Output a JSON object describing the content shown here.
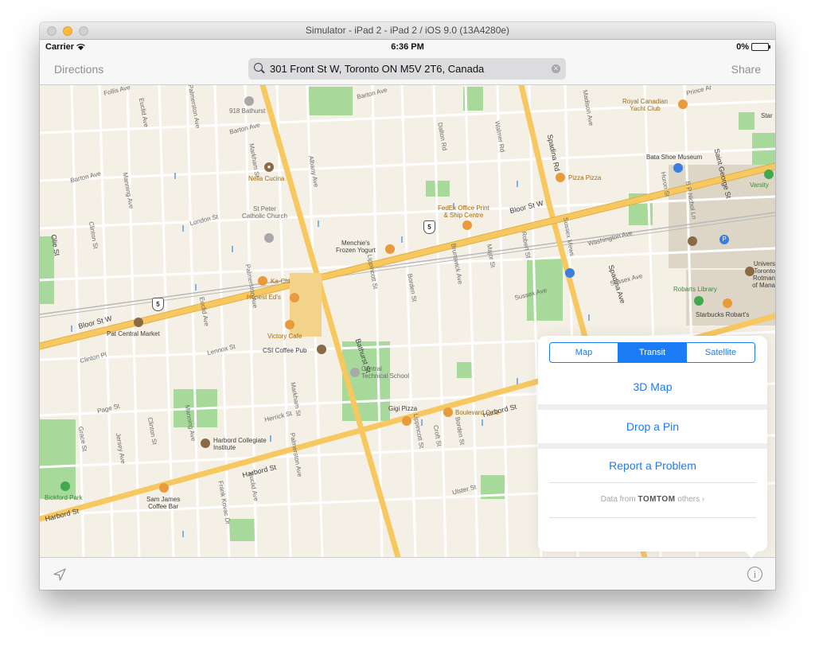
{
  "window": {
    "title": "Simulator - iPad 2 - iPad 2 / iOS 9.0 (13A4280e)"
  },
  "status_bar": {
    "carrier": "Carrier",
    "time": "6:36 PM",
    "battery": "0%"
  },
  "nav_bar": {
    "directions_label": "Directions",
    "search_value": "301 Front St W, Toronto ON M5V 2T6, Canada",
    "share_label": "Share"
  },
  "map": {
    "streets": {
      "bloor_w": "Bloor St W",
      "bloor_w2": "Bloor St W",
      "harbord": "Harbord St",
      "harbord2": "Harbord St",
      "harbord3": "Harbord St",
      "bathurst": "Bathurst St",
      "spadina": "Spadina Rd",
      "spadina_ave": "Spadina Ave",
      "barton": "Barton Ave",
      "barton2": "Barton Ave",
      "barton3": "Barton Ave",
      "london": "London St",
      "lennox": "Lennox St",
      "clinton_pl": "Clinton Pl",
      "page": "Page St",
      "herrick": "Herrick St",
      "ulster": "Ulster St",
      "sussex": "Sussex Ave",
      "sussex_mews": "Sussex Mews",
      "washington": "Washington Ave",
      "euclid": "Euclid Ave",
      "palmerston": "Palmerston Ave",
      "markham": "Markham St",
      "albany": "Albany Ave",
      "dalton": "Dalton Rd",
      "walmer": "Walmer Rd",
      "madison": "Madison Ave",
      "huron": "Huron St",
      "st_george": "Saint George St",
      "manning": "Manning Ave",
      "clinton": "Clinton St",
      "lippincott": "Lippincott St",
      "borden": "Borden St",
      "brunswick": "Brunswick Ave",
      "major": "Major St",
      "robert": "Robert St",
      "croft": "Croft St",
      "grace": "Grace St",
      "jersey": "Jersey Ave",
      "frank_kovac": "Frank Kovac Dr",
      "bpnichol": "B P Nichol Ln",
      "follis": "Follis Ave",
      "prince": "Prince Ar",
      "olmsted": "Olie St"
    },
    "places": {
      "bathurst918": "918 Bathurst",
      "nella": "Nella Cucina",
      "stpeter": "St Peter\nCatholic Church",
      "menchies": "Menchie's\nFrozen Yogurt",
      "fedex": "FedEx Office Print\n& Ship Centre",
      "pizza_pizza": "Pizza Pizza",
      "bata": "Bata Shoe Museum",
      "royal": "Royal Canadian\nYacht Club",
      "varsity": "Varsity",
      "ka_chi": "Ka-Chi",
      "honest": "Honest Ed's",
      "pat_central": "Pat Central Market",
      "victory": "Victory Cafe",
      "csi": "CSI Coffee Pub",
      "central_tech": "Central\nTechnical School",
      "gigi": "Gigi Pizza",
      "boulevard": "Boulevard Café",
      "harbord_ci": "Harbord Collegiate\nInstitute",
      "sam_james": "Sam James\nCoffee Bar",
      "bickford": "Bickford Park",
      "robarts": "Robarts Library",
      "starbucks": "Starbucks Robart's",
      "uoft": "Univers\nToronto\nRotman\nof Mana",
      "star": "Star"
    },
    "route_number": "5"
  },
  "popover": {
    "segments": [
      "Map",
      "Transit",
      "Satellite"
    ],
    "selected_segment": "Transit",
    "map_3d": "3D Map",
    "drop_pin": "Drop a Pin",
    "report": "Report a Problem",
    "attribution_prefix": "Data from",
    "attribution_brand": "TOMTOM",
    "attribution_suffix": "others ›"
  },
  "colors": {
    "accent": "#1b7cf6",
    "major_road": "#f6c85f",
    "park": "#9ed69a",
    "land": "#f4f0e6"
  },
  "icons": {
    "search": "magnifier",
    "clear": "clear-x",
    "location": "location-arrow",
    "info": "info-circle"
  }
}
